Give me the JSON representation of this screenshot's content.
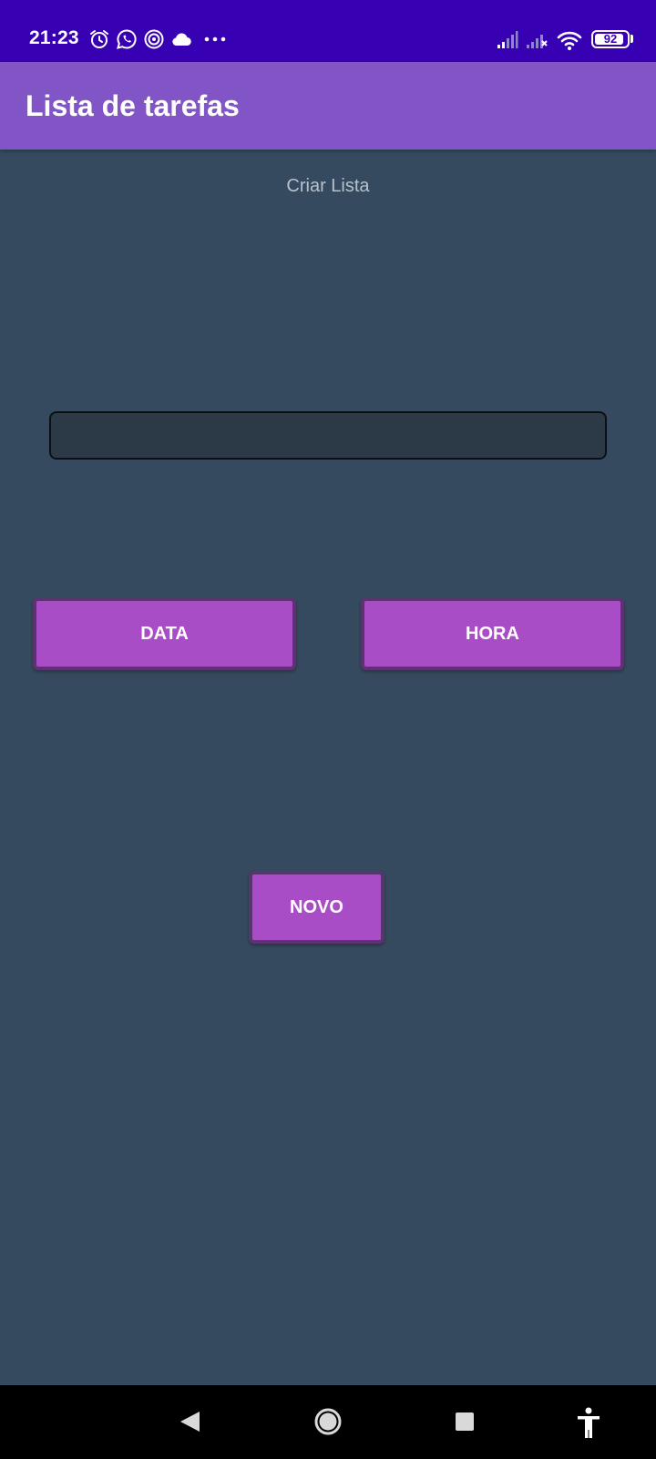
{
  "status_bar": {
    "time": "21:23",
    "battery_text": "92",
    "battery_level": 0.92,
    "icons": [
      "alarm-icon",
      "whatsapp-icon",
      "at-sign-icon",
      "cloud-icon",
      "more-dots-icon",
      "signal-icon",
      "signal-no-service-icon",
      "wifi-icon",
      "battery-icon"
    ]
  },
  "app_bar": {
    "title": "Lista de tarefas",
    "color": "#8155c6"
  },
  "main": {
    "subtitle": "Criar Lista",
    "task_input": {
      "value": "",
      "placeholder": ""
    },
    "date_button_label": "DATA",
    "time_button_label": "HORA",
    "new_button_label": "NOVO",
    "button_color": "#a94dc6",
    "background_color": "#354a5e"
  },
  "nav_bar": {
    "icons": [
      "back-icon",
      "home-icon",
      "recents-icon",
      "accessibility-icon"
    ]
  }
}
